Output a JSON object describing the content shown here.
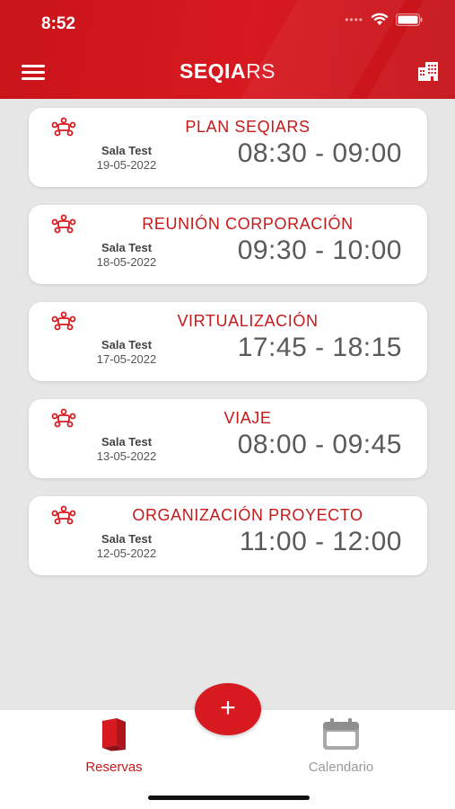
{
  "status_bar": {
    "time": "8:52"
  },
  "header": {
    "brand_bold": "SEQIA",
    "brand_light": "RS"
  },
  "reservations": [
    {
      "title": "PLAN SEQIARS",
      "room": "Sala Test",
      "date": "19-05-2022",
      "time": "08:30 - 09:00"
    },
    {
      "title": "REUNIÓN CORPORACIÓN",
      "room": "Sala Test",
      "date": "18-05-2022",
      "time": "09:30 - 10:00"
    },
    {
      "title": "VIRTUALIZACIÓN",
      "room": "Sala Test",
      "date": "17-05-2022",
      "time": "17:45 - 18:15"
    },
    {
      "title": "VIAJE",
      "room": "Sala Test",
      "date": "13-05-2022",
      "time": "08:00 - 09:45"
    },
    {
      "title": "ORGANIZACIÓN PROYECTO",
      "room": "Sala Test",
      "date": "12-05-2022",
      "time": "11:00 - 12:00"
    }
  ],
  "fab": {
    "label": "+"
  },
  "tabs": [
    {
      "label": "Reservas",
      "icon": "book-icon",
      "active": true
    },
    {
      "label": "Calendario",
      "icon": "calendar-icon",
      "active": false
    }
  ],
  "colors": {
    "accent": "#d71920",
    "background": "#e6e6e6",
    "inactive": "#9a9a9a"
  }
}
